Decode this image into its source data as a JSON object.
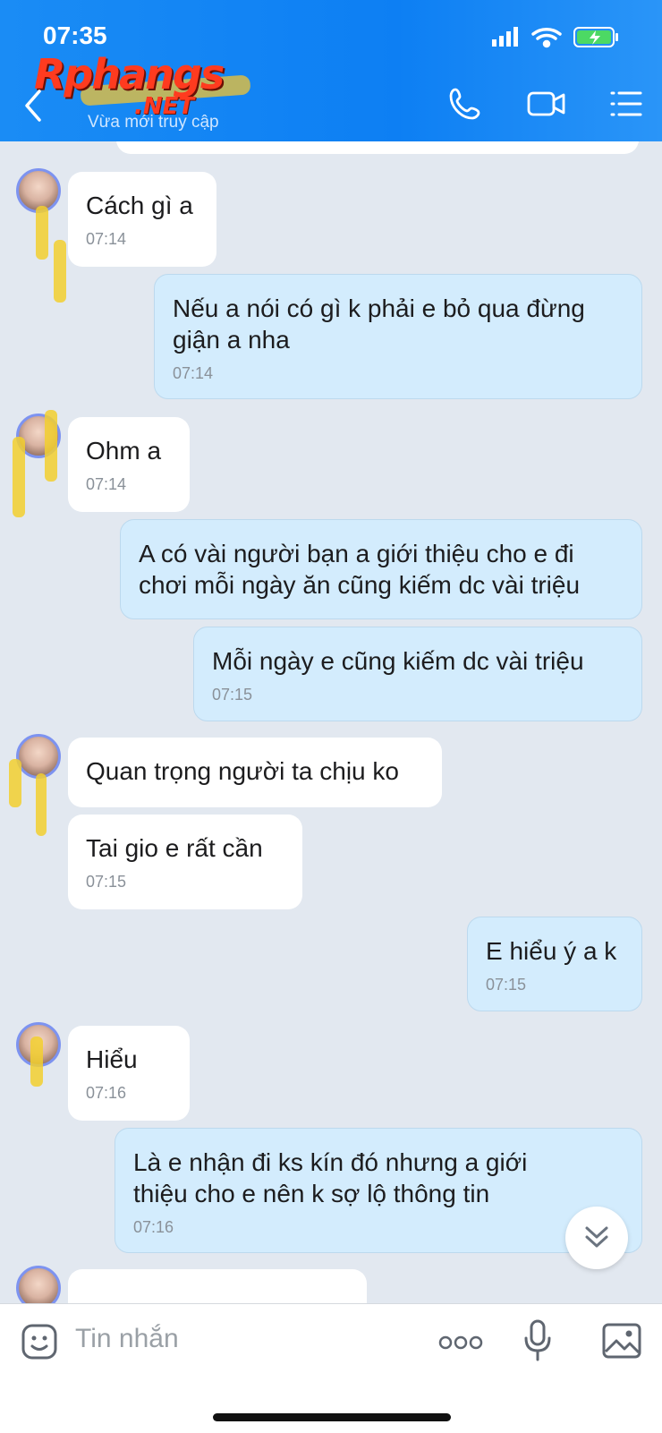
{
  "status_bar": {
    "time": "07:35"
  },
  "header": {
    "watermark_main": "Rphangs",
    "watermark_sub": ".NET",
    "subtitle": "Vừa mới truy cập",
    "color": "#1488f5"
  },
  "messages": [
    {
      "side": "in",
      "text": "Cách gì a",
      "time": "07:14",
      "avatar": true
    },
    {
      "side": "out",
      "text": "Nếu a nói có gì k phải e bỏ qua đừng giận a nha",
      "time": "07:14"
    },
    {
      "side": "in",
      "text": "Ohm a",
      "time": "07:14",
      "avatar": true
    },
    {
      "side": "out",
      "text": "A có vài người bạn a giới thiệu cho e đi chơi mỗi ngày ăn cũng kiếm dc vài triệu",
      "time": ""
    },
    {
      "side": "out",
      "text": "Mỗi ngày e cũng kiếm dc vài triệu",
      "time": "07:15"
    },
    {
      "side": "in",
      "text": "Quan trọng người ta chịu ko",
      "time": "",
      "avatar": true
    },
    {
      "side": "in",
      "text": "Tai gio e rất cần",
      "time": "07:15"
    },
    {
      "side": "out",
      "text": "E hiểu ý a k",
      "time": "07:15"
    },
    {
      "side": "in",
      "text": "Hiểu",
      "time": "07:16",
      "avatar": true
    },
    {
      "side": "out",
      "text": "Là e nhận đi ks kín đó nhưng a giới thiệu cho e nên k sợ lộ thông tin",
      "time": "07:16"
    }
  ],
  "composer": {
    "placeholder": "Tin nhắn"
  },
  "icons": [
    "back-icon",
    "phone-icon",
    "video-call-icon",
    "menu-icon",
    "sticker-icon",
    "more-icon",
    "microphone-icon",
    "image-icon",
    "scroll-down-icon"
  ]
}
